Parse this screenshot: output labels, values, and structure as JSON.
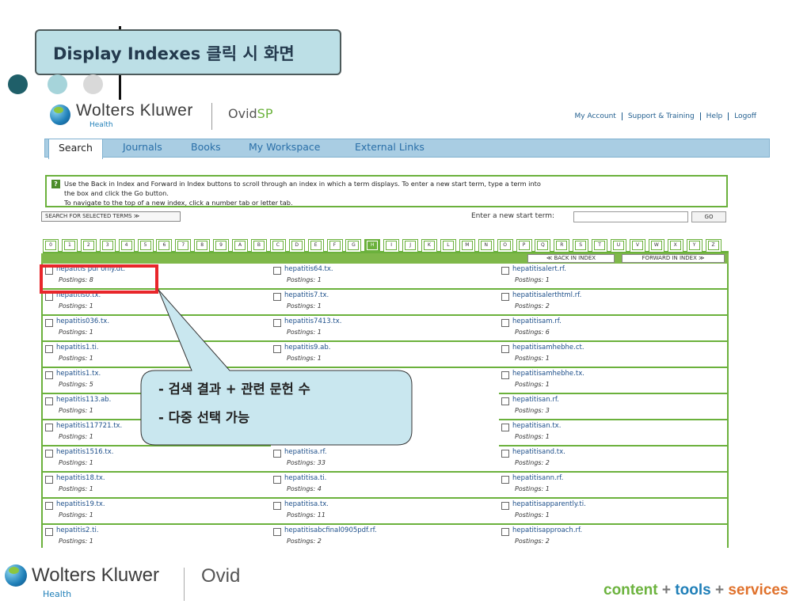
{
  "slide": {
    "title": "Display Indexes 클릭 시 화면",
    "dot_colors": [
      "#1f5f69",
      "#a6d4da",
      "#d9d9d9"
    ]
  },
  "header": {
    "logo_text": "Wolters Kluwer",
    "logo_sub": "Health",
    "product_prefix": "Ovid",
    "product_suffix": "SP",
    "links": [
      "My Account",
      "Support & Training",
      "Help",
      "Logoff"
    ]
  },
  "nav": {
    "tabs": [
      "Search",
      "Journals",
      "Books",
      "My Workspace",
      "External Links"
    ],
    "active": "Search"
  },
  "info": {
    "line1": "Use the Back in Index and Forward in Index buttons to scroll through an index in which a term displays. To enter a new start term, type a term into",
    "line2": "the box and click the Go button.",
    "line3": "To navigate to the top of a new index, click a number tab or letter tab."
  },
  "controls": {
    "search_selected": "SEARCH FOR SELECTED TERMS ≫",
    "start_term_label": "Enter a new start term:",
    "start_term_value": "",
    "go": "GO",
    "back": "≪ BACK IN INDEX",
    "forward": "FORWARD IN INDEX ≫"
  },
  "index_tabs": [
    "0",
    "1",
    "2",
    "3",
    "4",
    "5",
    "6",
    "7",
    "8",
    "9",
    "A",
    "B",
    "C",
    "D",
    "E",
    "F",
    "G",
    "H",
    "I",
    "J",
    "K",
    "L",
    "M",
    "N",
    "O",
    "P",
    "Q",
    "R",
    "S",
    "T",
    "U",
    "V",
    "W",
    "X",
    "Y",
    "Z"
  ],
  "active_tab": "H",
  "columns": [
    [
      {
        "term": "hepatitis pdf only.dt.",
        "postings": "Postings: 8"
      },
      {
        "term": "hepatitis0.tx.",
        "postings": "Postings: 1"
      },
      {
        "term": "hepatitis036.tx.",
        "postings": "Postings: 1"
      },
      {
        "term": "hepatitis1.ti.",
        "postings": "Postings: 1"
      },
      {
        "term": "hepatitis1.tx.",
        "postings": "Postings: 5"
      },
      {
        "term": "hepatitis113.ab.",
        "postings": "Postings: 1"
      },
      {
        "term": "hepatitis117721.tx.",
        "postings": "Postings: 1"
      },
      {
        "term": "hepatitis1516.tx.",
        "postings": "Postings: 1"
      },
      {
        "term": "hepatitis18.tx.",
        "postings": "Postings: 1"
      },
      {
        "term": "hepatitis19.tx.",
        "postings": "Postings: 1"
      },
      {
        "term": "hepatitis2.ti.",
        "postings": "Postings: 1"
      }
    ],
    [
      {
        "term": "hepatitis64.tx.",
        "postings": "Postings: 1"
      },
      {
        "term": "hepatitis7.tx.",
        "postings": "Postings: 1"
      },
      {
        "term": "hepatitis7413.tx.",
        "postings": "Postings: 1"
      },
      {
        "term": "hepatitis9.ab.",
        "postings": "Postings: 1"
      },
      {
        "term": "",
        "postings": ""
      },
      {
        "term": "",
        "postings": ""
      },
      {
        "term": "",
        "postings": ""
      },
      {
        "term": "hepatitisa.rf.",
        "postings": "Postings: 33"
      },
      {
        "term": "hepatitisa.ti.",
        "postings": "Postings: 4"
      },
      {
        "term": "hepatitisa.tx.",
        "postings": "Postings: 11"
      },
      {
        "term": "hepatitisabcfinal0905pdf.rf.",
        "postings": "Postings: 2"
      }
    ],
    [
      {
        "term": "hepatitisalert.rf.",
        "postings": "Postings: 1"
      },
      {
        "term": "hepatitisalerthtml.rf.",
        "postings": "Postings: 2"
      },
      {
        "term": "hepatitisam.rf.",
        "postings": "Postings: 6"
      },
      {
        "term": "hepatitisamhebhe.ct.",
        "postings": "Postings: 1"
      },
      {
        "term": "hepatitisamhebhe.tx.",
        "postings": "Postings: 1"
      },
      {
        "term": "hepatitisan.rf.",
        "postings": "Postings: 3"
      },
      {
        "term": "hepatitisan.tx.",
        "postings": "Postings: 1"
      },
      {
        "term": "hepatitisand.tx.",
        "postings": "Postings: 2"
      },
      {
        "term": "hepatitisann.rf.",
        "postings": "Postings: 1"
      },
      {
        "term": "hepatitisapparently.ti.",
        "postings": "Postings: 1"
      },
      {
        "term": "hepatitisapproach.rf.",
        "postings": "Postings: 2"
      }
    ]
  ],
  "callout": {
    "line1": "- 검색 결과 + 관련 문헌 수",
    "line2": "- 다중 선택 가능"
  },
  "footer": {
    "logo_text": "Wolters Kluwer",
    "logo_sub": "Health",
    "product": "Ovid",
    "tag_content": "content",
    "tag_tools": "tools",
    "tag_services": "services",
    "plus": "+"
  }
}
